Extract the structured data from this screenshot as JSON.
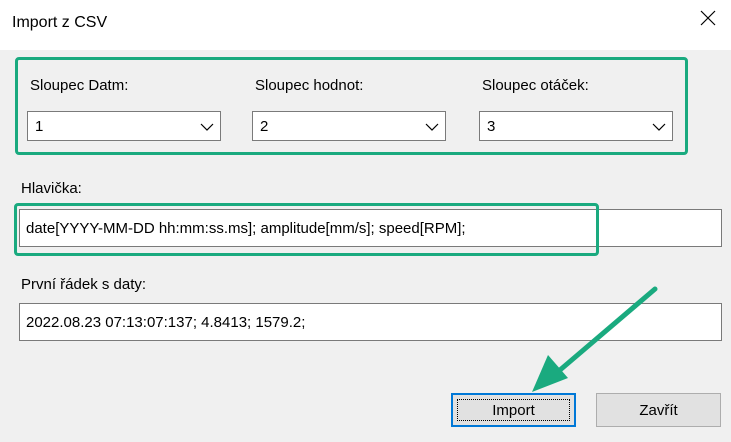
{
  "window": {
    "title": "Import z CSV"
  },
  "columns": {
    "date_label": "Sloupec Datm:",
    "date_value": "1",
    "value_label": "Sloupec hodnot:",
    "value_value": "2",
    "rpm_label": "Sloupec otáček:",
    "rpm_value": "3"
  },
  "header": {
    "label": "Hlavička:",
    "value": "date[YYYY-MM-DD hh:mm:ss.ms]; amplitude[mm/s]; speed[RPM];"
  },
  "first_row": {
    "label": "První řádek s daty:",
    "value": "2022.08.23 07:13:07:137; 4.8413; 1579.2;"
  },
  "buttons": {
    "import_label": "Import",
    "close_label": "Zavřít"
  },
  "annotation": {
    "highlight_color": "#1aaa7f"
  }
}
